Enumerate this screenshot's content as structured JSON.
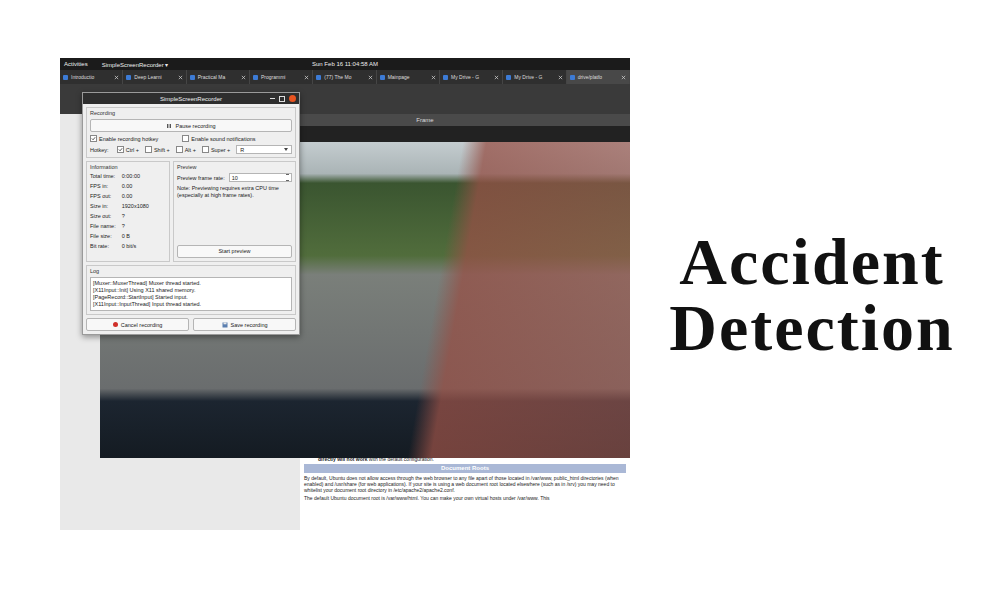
{
  "headline": {
    "lines": [
      "Accident",
      "Detection"
    ]
  },
  "topbar": {
    "activities": "Activities",
    "app_menu": "SimpleScreenRecorder ▾",
    "clock": "Sun Feb 16 11:04:58 AM"
  },
  "tabs": [
    {
      "label": "Introductio",
      "selected": false
    },
    {
      "label": "Deep Learni",
      "selected": false
    },
    {
      "label": "Practical Ma",
      "selected": false
    },
    {
      "label": "Programmi",
      "selected": false
    },
    {
      "label": "(77) The Mo",
      "selected": false
    },
    {
      "label": "Mainpage",
      "selected": false
    },
    {
      "label": "My Drive - G",
      "selected": false
    },
    {
      "label": "My Drive - G",
      "selected": false
    },
    {
      "label": "drive/platfo",
      "selected": true
    }
  ],
  "frame_window": {
    "title": "Frame"
  },
  "recorder": {
    "title": "SimpleScreenRecorder",
    "recording_group": "Recording",
    "pause_button": "Pause recording",
    "options": [
      {
        "label": "Enable recording hotkey",
        "checked": true
      },
      {
        "label": "Enable sound notifications",
        "checked": false
      }
    ],
    "hotkey": {
      "label": "Hotkey:",
      "modifiers": [
        {
          "label": "Ctrl +",
          "checked": true
        },
        {
          "label": "Shift +",
          "checked": false
        },
        {
          "label": "Alt +",
          "checked": false
        },
        {
          "label": "Super +",
          "checked": false
        }
      ],
      "key": "R"
    },
    "information": {
      "title": "Information",
      "rows": [
        {
          "label": "Total time:",
          "value": "0:00:00"
        },
        {
          "label": "FPS in:",
          "value": "0.00"
        },
        {
          "label": "FPS out:",
          "value": "0.00"
        },
        {
          "label": "Size in:",
          "value": "1920x1080"
        },
        {
          "label": "Size out:",
          "value": "?"
        },
        {
          "label": "File name:",
          "value": "?"
        },
        {
          "label": "File size:",
          "value": "0 B"
        },
        {
          "label": "Bit rate:",
          "value": "0 bit/s"
        }
      ]
    },
    "preview": {
      "title": "Preview",
      "rate_label": "Preview frame rate:",
      "rate": "10",
      "note": "Note: Previewing requires extra CPU time (especially at high frame rates).",
      "button": "Start preview"
    },
    "log": {
      "title": "Log",
      "lines": [
        "[Muxer::MuxerThread] Muxer thread started.",
        "[X11Input::Init] Using X11 shared memory.",
        "[PageRecord::StartInput] Started input.",
        "[X11Input::InputThread] Input thread started."
      ]
    },
    "buttons": [
      {
        "label": "Cancel recording",
        "kind": "cancel"
      },
      {
        "label": "Save recording",
        "kind": "save"
      }
    ]
  },
  "webpage": {
    "intro_bold": "directly will not work",
    "intro_rest": " with the default configuration.",
    "heading": "Document Roots",
    "paragraphs": [
      "By default, Ubuntu does not allow access through the web browser to any file apart of those located in /var/www, public_html directories (when enabled) and /usr/share (for web applications). If your site is using a web document root located elsewhere (such as in /srv) you may need to whitelist your document root directory in /etc/apache2/apache2.conf.",
      "The default Ubuntu document root is /var/www/html. You can make your own virtual hosts under /var/www. This"
    ]
  }
}
